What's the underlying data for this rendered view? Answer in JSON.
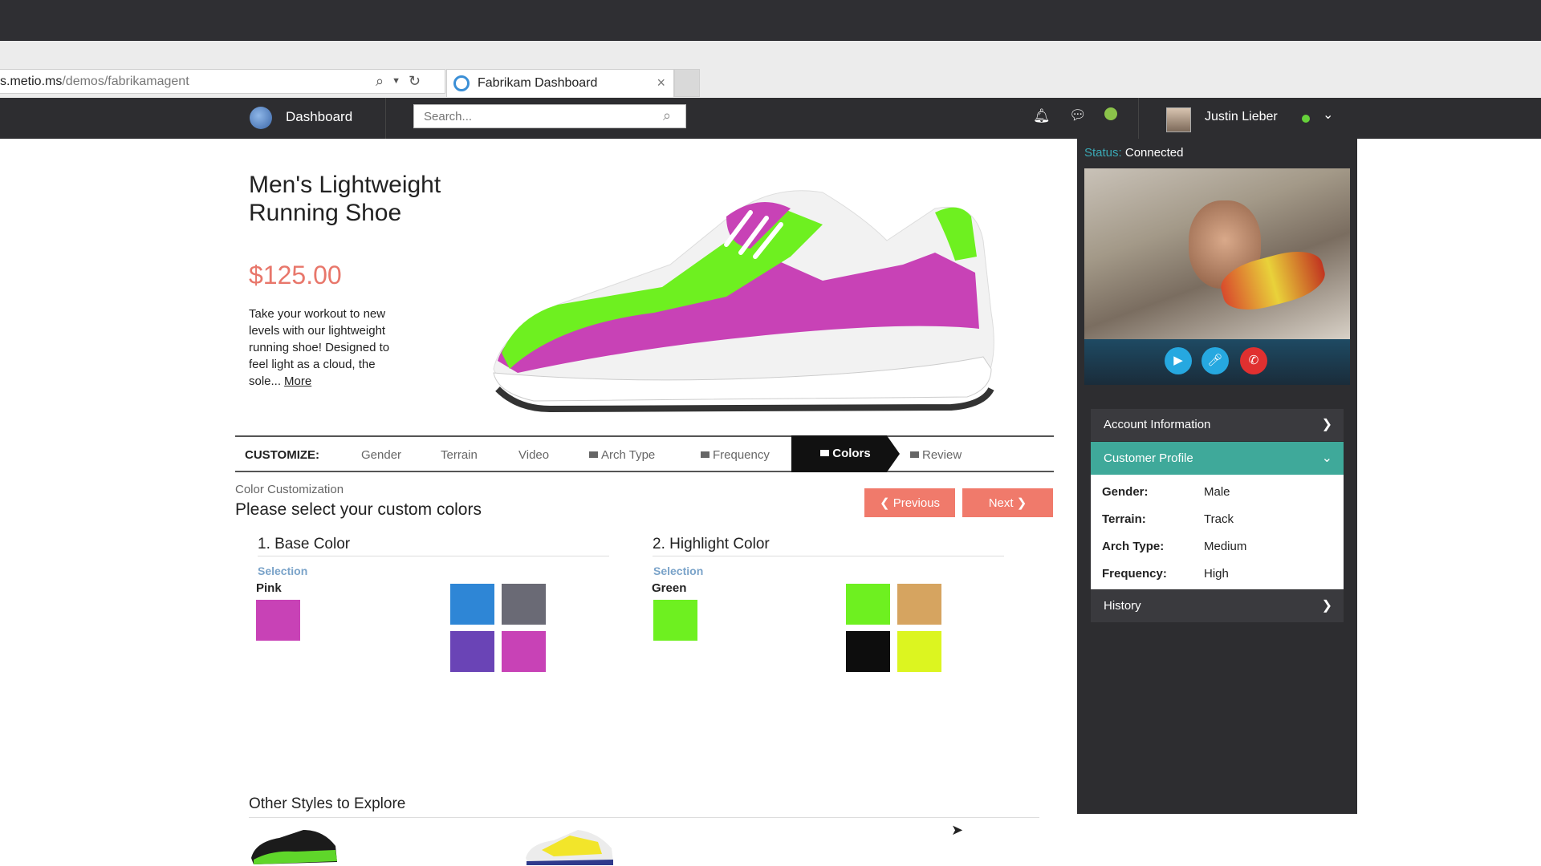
{
  "browser": {
    "url_prefix": "s.metio.ms",
    "url_path": "/demos/fabrikamagent",
    "tab_title": "Fabrikam Dashboard",
    "tab_close": "×"
  },
  "header": {
    "title": "Dashboard",
    "search_placeholder": "Search...",
    "user_name": "Justin Lieber"
  },
  "product": {
    "title": "Men's Lightweight Running Shoe",
    "price": "$125.00",
    "description": "Take your workout to new levels with our lightweight running shoe! Designed to feel light as a cloud, the sole...",
    "more_link": "More"
  },
  "customize": {
    "label": "CUSTOMIZE:",
    "tabs": [
      "Gender",
      "Terrain",
      "Video",
      "Arch Type",
      "Frequency",
      "Colors",
      "Review"
    ],
    "active_tab": "Colors"
  },
  "color_section": {
    "subtitle": "Color Customization",
    "title": "Please select your custom colors",
    "prev_label": "Previous",
    "next_label": "Next",
    "base": {
      "heading": "1. Base Color",
      "selection_label": "Selection",
      "selected": "Pink",
      "selected_color": "#c842b6",
      "options": [
        "#2e86d6",
        "#6a6a75",
        "#6a44b6",
        "#c842b6"
      ]
    },
    "highlight": {
      "heading": "2. Highlight Color",
      "selection_label": "Selection",
      "selected": "Green",
      "selected_color": "#6ef020",
      "options": [
        "#6ef020",
        "#d6a460",
        "#0d0d0d",
        "#dcf520"
      ]
    }
  },
  "other_styles": {
    "heading": "Other Styles to Explore"
  },
  "agent_panel": {
    "status_label": "Status:",
    "status_value": "Connected",
    "account_info": "Account Information",
    "customer_profile": "Customer Profile",
    "profile": [
      {
        "key": "Gender:",
        "value": "Male"
      },
      {
        "key": "Terrain:",
        "value": "Track"
      },
      {
        "key": "Arch Type:",
        "value": "Medium"
      },
      {
        "key": "Frequency:",
        "value": "High"
      }
    ],
    "history": "History"
  }
}
